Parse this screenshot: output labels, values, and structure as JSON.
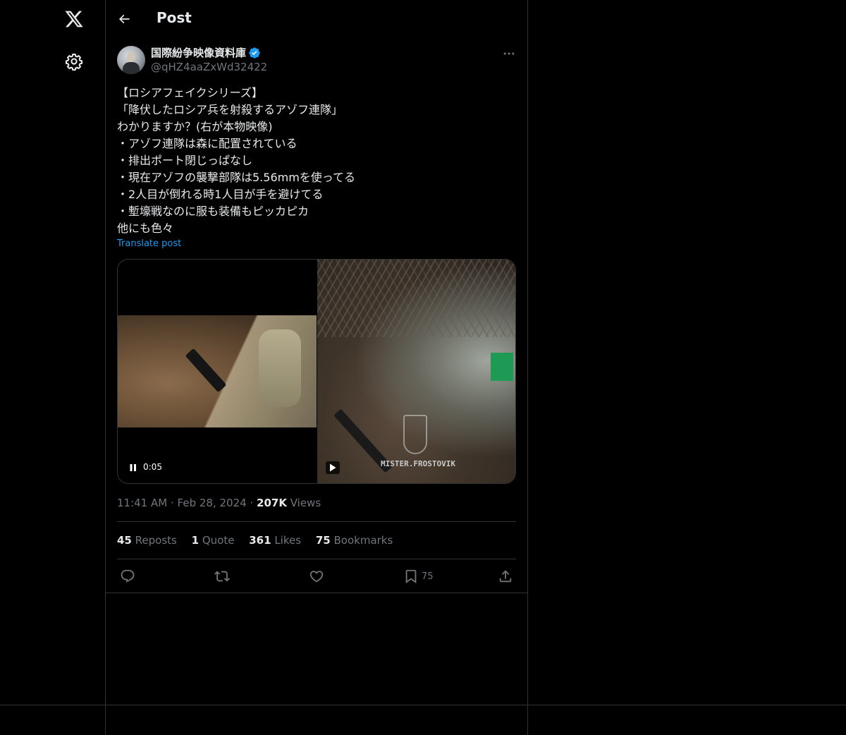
{
  "header": {
    "title": "Post"
  },
  "post": {
    "author_name": "国際紛争映像資料庫",
    "author_handle": "@qHZ4aaZxWd32422",
    "lines": [
      "【ロシアフェイクシリーズ】",
      "「降伏したロシア兵を射殺するアゾフ連隊」",
      "わかりますか？(右が本物映像)",
      "・アゾフ連隊は森に配置されている",
      "・排出ポート閉じっぱなし",
      "・現在アゾフの襲撃部隊は5.56mmを使ってる",
      "・2人目が倒れる時1人目が手を避けてる",
      "・塹壕戦なのに服も装備もピッカピカ",
      "他にも色々"
    ],
    "translate_label": "Translate post",
    "video_time": "0:05",
    "watermark": "MISTER.FROSTOVIK",
    "time": "11:41 AM",
    "date": "Feb 28, 2024",
    "dot": "·",
    "views_count": "207K",
    "views_label": "Views"
  },
  "stats": {
    "reposts_count": "45",
    "reposts_label": "Reposts",
    "quotes_count": "1",
    "quotes_label": "Quote",
    "likes_count": "361",
    "likes_label": "Likes",
    "bookmarks_count": "75",
    "bookmarks_label": "Bookmarks"
  },
  "actions": {
    "bookmark_count": "75"
  },
  "icons": [
    "x-logo-icon",
    "settings-gear-icon",
    "back-arrow-icon",
    "verified-badge-icon",
    "more-options-icon",
    "pause-icon",
    "play-icon",
    "reply-icon",
    "repost-icon",
    "like-heart-icon",
    "bookmark-icon",
    "share-icon"
  ],
  "colors": {
    "background": "#000000",
    "text": "#e7e9ea",
    "muted": "#71767b",
    "accent": "#1d9bf0",
    "border": "#2f3336"
  }
}
